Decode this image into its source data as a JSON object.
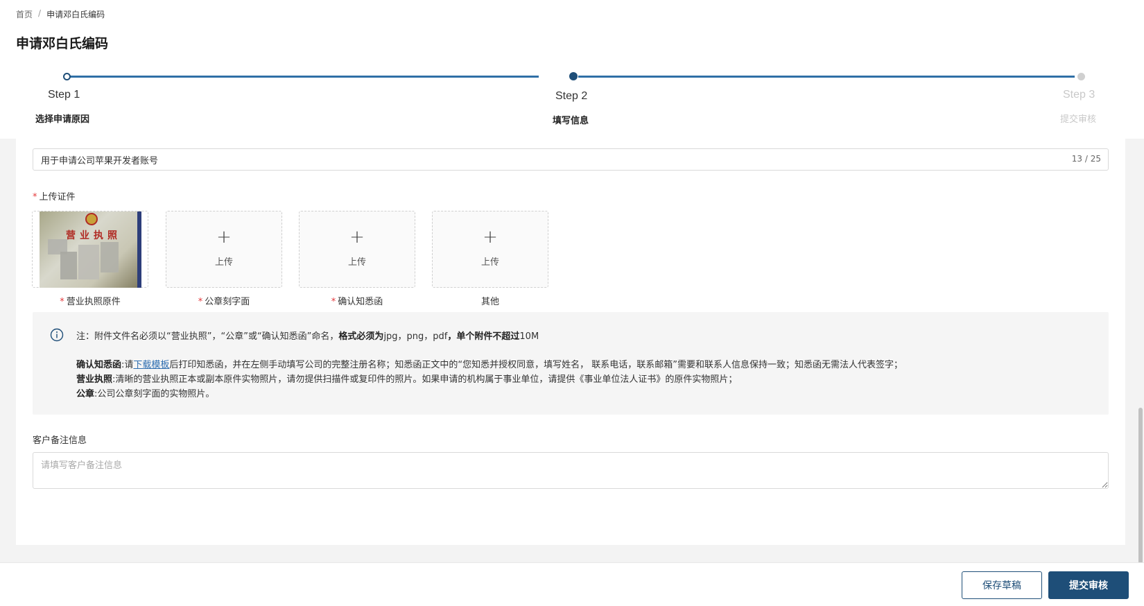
{
  "breadcrumb": {
    "home": "首页",
    "separator": "/",
    "current": "申请邓白氏编码"
  },
  "page_title": "申请邓白氏编码",
  "steps": [
    {
      "title": "Step 1",
      "desc": "选择申请原因",
      "status": "finished"
    },
    {
      "title": "Step 2",
      "desc": "填写信息",
      "status": "current"
    },
    {
      "title": "Step 3",
      "desc": "提交审核",
      "status": "wait"
    }
  ],
  "reason": {
    "value": "用于申请公司苹果开发者账号",
    "count": "13 / 25"
  },
  "upload": {
    "label": "上传证件",
    "required_mark": "*",
    "upload_text": "上传",
    "plus": "+",
    "slots": [
      {
        "name": "营业执照原件",
        "required": true,
        "has_image": true,
        "image_text": "营业执照"
      },
      {
        "name": "公章刻字面",
        "required": true,
        "has_image": false
      },
      {
        "name": "确认知悉函",
        "required": true,
        "has_image": false
      },
      {
        "name": "其他",
        "required": false,
        "has_image": false
      }
    ]
  },
  "notice": {
    "line1_prefix": "注：附件文件名必须以“营业执照”，“公章”或“确认知悉函”命名，",
    "line1_bold1": "格式必须为",
    "line1_formats": "jpg，png，pdf",
    "line1_bold2": "，单个附件不超过",
    "line1_size": "10M",
    "confirm_label": "确认知悉函",
    "confirm_pre": ":请",
    "confirm_link": "下载模板",
    "confirm_post": "后打印知悉函，并在左侧手动填写公司的完整注册名称；知悉函正文中的“您知悉并授权同意，填写姓名， 联系电话，联系邮箱”需要和联系人信息保持一致；知悉函无需法人代表签字；",
    "license_label": "营业执照",
    "license_text": ":清晰的营业执照正本或副本原件实物照片，请勿提供扫描件或复印件的照片。如果申请的机构属于事业单位，请提供《事业单位法人证书》的原件实物照片；",
    "seal_label": "公章",
    "seal_text": ":公司公章刻字面的实物照片。",
    "icon": "info-circle-icon"
  },
  "remark": {
    "label": "客户备注信息",
    "placeholder": "请填写客户备注信息",
    "value": ""
  },
  "footer": {
    "save_draft": "保存草稿",
    "submit": "提交审核"
  },
  "colors": {
    "primary": "#1e4e78",
    "progress": "#2f6fa6",
    "required": "#e4393c",
    "link": "#2d6db0"
  }
}
